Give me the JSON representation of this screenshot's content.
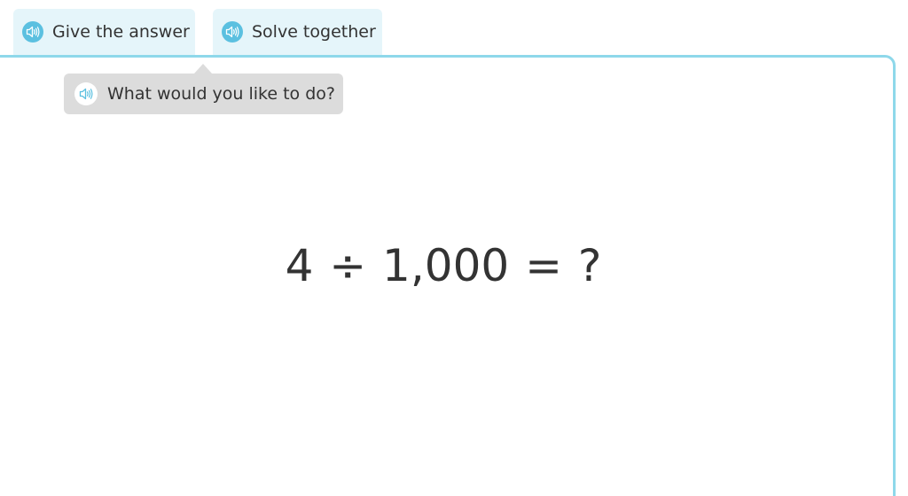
{
  "tabs": [
    {
      "label": "Give the answer",
      "icon": "speaker-icon"
    },
    {
      "label": "Solve together",
      "icon": "speaker-icon"
    }
  ],
  "prompt": {
    "text": "What would you like to do?",
    "icon": "speaker-icon"
  },
  "problem": {
    "equation": "4 ÷ 1,000 = ?"
  },
  "colors": {
    "tab_bg": "#e5f5fa",
    "accent": "#5bc0e0",
    "panel_border": "#8ed8ea",
    "bubble_bg": "#dcdcdc",
    "text": "#333333"
  }
}
